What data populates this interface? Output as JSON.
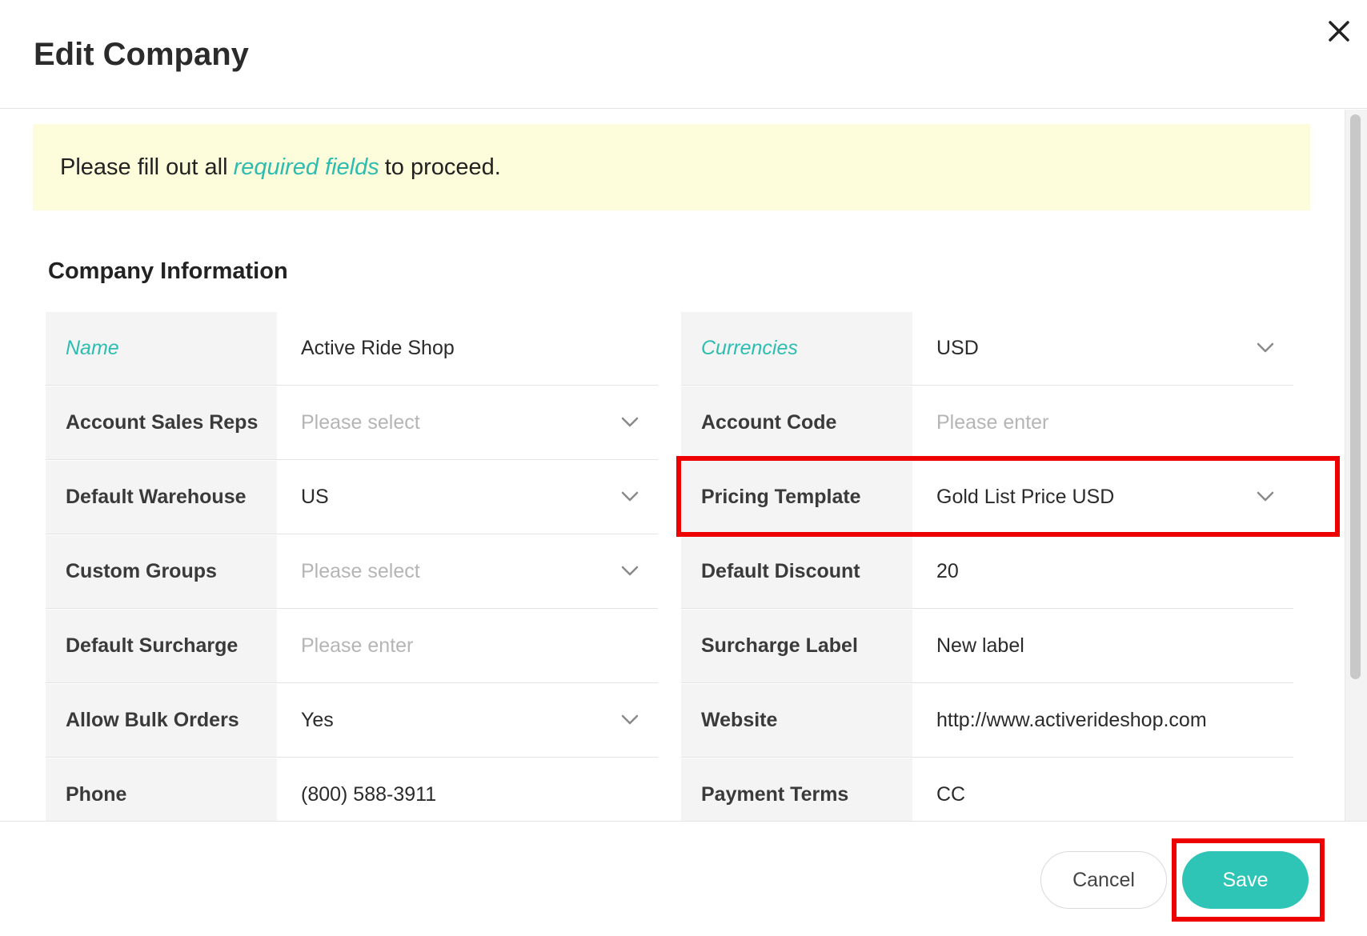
{
  "dialog": {
    "title": "Edit Company",
    "close_icon": "close-icon"
  },
  "notice": {
    "prefix": "Please fill out all",
    "link": "required fields",
    "suffix": "to proceed."
  },
  "section": {
    "title": "Company Information"
  },
  "left_fields": [
    {
      "label": "Name",
      "value": "Active Ride Shop",
      "required": true,
      "dropdown": false,
      "placeholder": false
    },
    {
      "label": "Account Sales Reps",
      "value": "Please select",
      "required": false,
      "dropdown": true,
      "placeholder": true
    },
    {
      "label": "Default Warehouse",
      "value": "US",
      "required": false,
      "dropdown": true,
      "placeholder": false
    },
    {
      "label": "Custom Groups",
      "value": "Please select",
      "required": false,
      "dropdown": true,
      "placeholder": true
    },
    {
      "label": "Default Surcharge",
      "value": "Please enter",
      "required": false,
      "dropdown": false,
      "placeholder": true
    },
    {
      "label": "Allow Bulk Orders",
      "value": "Yes",
      "required": false,
      "dropdown": true,
      "placeholder": false
    },
    {
      "label": "Phone",
      "value": "(800) 588-3911",
      "required": false,
      "dropdown": false,
      "placeholder": false
    }
  ],
  "right_fields": [
    {
      "label": "Currencies",
      "value": "USD",
      "required": true,
      "dropdown": true,
      "placeholder": false
    },
    {
      "label": "Account Code",
      "value": "Please enter",
      "required": false,
      "dropdown": false,
      "placeholder": true
    },
    {
      "label": "Pricing Template",
      "value": "Gold List Price USD",
      "required": false,
      "dropdown": true,
      "placeholder": false
    },
    {
      "label": "Default Discount",
      "value": "20",
      "required": false,
      "dropdown": false,
      "placeholder": false
    },
    {
      "label": "Surcharge Label",
      "value": "New label",
      "required": false,
      "dropdown": false,
      "placeholder": false
    },
    {
      "label": "Website",
      "value": "http://www.activerideshop.com",
      "required": false,
      "dropdown": false,
      "placeholder": false
    },
    {
      "label": "Payment Terms",
      "value": "CC",
      "required": false,
      "dropdown": false,
      "placeholder": false
    }
  ],
  "footer": {
    "cancel_label": "Cancel",
    "save_label": "Save"
  },
  "colors": {
    "accent": "#2ec4b6",
    "highlight": "#ee0000",
    "notice_bg": "#fdfcdb"
  }
}
